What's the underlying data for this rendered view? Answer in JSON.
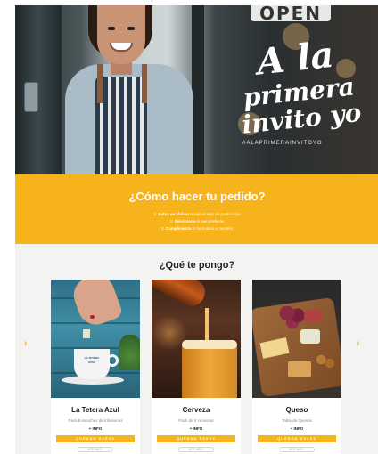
{
  "hero": {
    "sign_text": "OPEN",
    "headline_line1": "A la",
    "headline_line2": "primera",
    "headline_line3": "invito yo",
    "hashtag": "#ALAPRIMERAINVITOYO"
  },
  "how_to": {
    "title": "¿Cómo hacer tu pedido?",
    "steps": [
      {
        "num": "1.",
        "bold": "Estoy en chilaut",
        "rest": " a todo el sitio de producción"
      },
      {
        "num": "2.",
        "bold": "Selecciona",
        "rest": " el que prefieras"
      },
      {
        "num": "3.",
        "bold": "Cumplimenta",
        "rest": " el formulario y ¡reciélo!"
      }
    ]
  },
  "products": {
    "title": "¿Qué te pongo?",
    "prev_arrow": "›",
    "next_arrow": "›",
    "items": [
      {
        "title": "La Tetera Azul",
        "subtitle": "Pack 8 estuches de Infusiones",
        "info": "+ INFO",
        "cta": "QUEDAN XXXXX",
        "secondary": "VER MÁS ›",
        "cup_logo": "LA TETERA AZUL"
      },
      {
        "title": "Cerveza",
        "subtitle": "Pack de 4 cervezas",
        "info": "+ INFO",
        "cta": "QUEDAN XXXXX",
        "secondary": "VER MÁS ›"
      },
      {
        "title": "Queso",
        "subtitle": "Tabla de Quesos",
        "info": "+ INFO",
        "cta": "QUEDAN XXXXX",
        "secondary": "VER MÁS ›"
      }
    ]
  },
  "colors": {
    "accent": "#f6b31b",
    "section_bg": "#f3f3f2"
  }
}
